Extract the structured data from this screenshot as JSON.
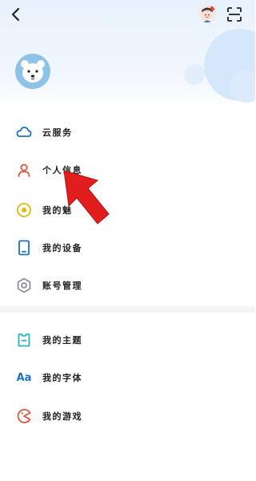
{
  "header": {
    "back_icon": "chevron-left-icon",
    "avatar_icon": "user-avatar-icon",
    "scan_icon": "scan-icon"
  },
  "profile": {
    "avatar_icon": "polar-bear-avatar-icon"
  },
  "menu": {
    "items": [
      {
        "label": "云服务",
        "icon": "cloud-icon",
        "color": "#1a73c8"
      },
      {
        "label": "个人信息",
        "icon": "person-icon",
        "color": "#e0533d"
      },
      {
        "label": "我的魅",
        "icon": "target-icon",
        "color": "#e6b800"
      },
      {
        "label": "我的设备",
        "icon": "device-icon",
        "color": "#1a73c8"
      },
      {
        "label": "账号管理",
        "icon": "gear-icon",
        "color": "#8a8f98"
      }
    ],
    "secondary_items": [
      {
        "label": "我的主题",
        "icon": "theme-icon",
        "color": "#25b4c4"
      },
      {
        "label": "我的字体",
        "icon": "font-icon",
        "color": "#1a73c8",
        "icon_text": "Aa"
      },
      {
        "label": "我的游戏",
        "icon": "game-icon",
        "color": "#e0533d"
      }
    ]
  },
  "colors": {
    "header_bg": "#e8f2fc",
    "arrow": "#e21d1d"
  }
}
